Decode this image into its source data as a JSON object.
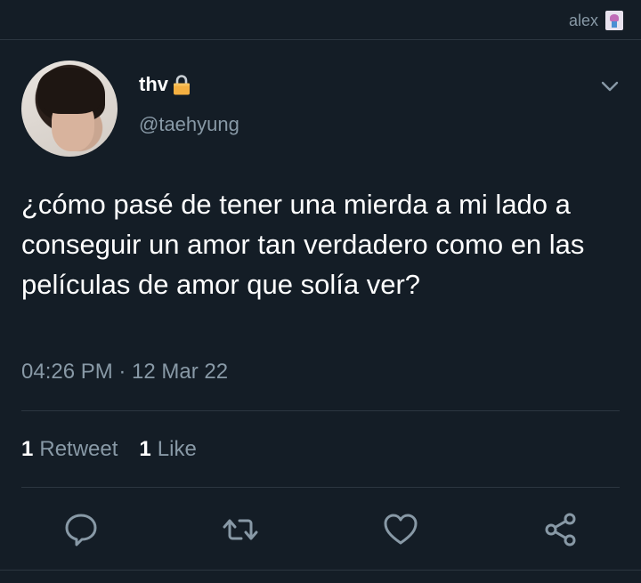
{
  "topbar": {
    "username": "alex"
  },
  "tweet": {
    "display_name": "thv",
    "handle": "@taehyung",
    "text": "¿cómo pasé de tener una mierda a mi lado a conseguir un amor tan verdadero como en las películas de amor que solía ver?",
    "timestamp": "04:26 PM · 12 Mar 22",
    "retweet_count": "1",
    "retweet_label": "Retweet",
    "like_count": "1",
    "like_label": "Like"
  },
  "icons": {
    "lock": "lock-icon",
    "menu": "chevron-down-icon",
    "reply": "reply-icon",
    "retweet": "retweet-icon",
    "like": "heart-icon",
    "share": "share-icon"
  },
  "colors": {
    "background": "#141d26",
    "secondary_text": "#8899a6",
    "divider": "#2c3640",
    "lock": "#f5b041"
  }
}
